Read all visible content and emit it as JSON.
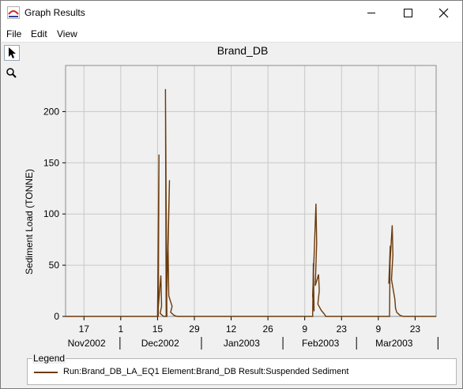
{
  "window": {
    "title": "Graph Results"
  },
  "menu": {
    "file": "File",
    "edit": "Edit",
    "view": "View"
  },
  "legend": {
    "title": "Legend",
    "entry": "Run:Brand_DB_LA_EQ1 Element:Brand_DB Result:Suspended Sediment",
    "line_color": "#6b3a0c"
  },
  "colors": {
    "series": "#6b3a0c",
    "grid": "#c8c8c8",
    "plot_border": "#8c8c8c"
  },
  "chart_data": {
    "type": "line",
    "title": "Brand_DB",
    "ylabel": "Sediment Load (TONNE)",
    "xlabel": "",
    "xlim": [
      "2002-11-10",
      "2003-03-31"
    ],
    "ylim": [
      0,
      245
    ],
    "yticks": [
      0,
      50,
      100,
      150,
      200
    ],
    "xticks_major": [
      "2002-11-17",
      "2002-12-01",
      "2002-12-15",
      "2002-12-29",
      "2003-01-12",
      "2003-01-26",
      "2003-02-09",
      "2003-02-23",
      "2003-03-09",
      "2003-03-23"
    ],
    "xtick_labels_major": [
      "17",
      "1",
      "15",
      "29",
      "12",
      "26",
      "9",
      "23",
      "9",
      "23"
    ],
    "month_boundaries": [
      "2002-12-01",
      "2003-01-01",
      "2003-02-01",
      "2003-03-01",
      "2003-04-01"
    ],
    "month_labels": [
      {
        "label": "Nov2002",
        "center": "2002-11-18"
      },
      {
        "label": "Dec2002",
        "center": "2002-12-16"
      },
      {
        "label": "Jan2003",
        "center": "2003-01-16"
      },
      {
        "label": "Feb2003",
        "center": "2003-02-15"
      },
      {
        "label": "Mar2003",
        "center": "2003-03-15"
      }
    ],
    "grid": true,
    "legend": "bottom",
    "series": [
      {
        "name": "Run:Brand_DB_LA_EQ1 Element:Brand_DB Result:Suspended Sediment",
        "points": [
          [
            "2002-11-10",
            0
          ],
          [
            "2002-12-15",
            0
          ],
          [
            "2002-12-15",
            158
          ],
          [
            "2002-12-15",
            0
          ],
          [
            "2002-12-16",
            40
          ],
          [
            "2002-12-16",
            10
          ],
          [
            "2002-12-16",
            3
          ],
          [
            "2002-12-17",
            0
          ],
          [
            "2002-12-18",
            0
          ],
          [
            "2002-12-18",
            222
          ],
          [
            "2002-12-18",
            0
          ],
          [
            "2002-12-19",
            133
          ],
          [
            "2002-12-19",
            67
          ],
          [
            "2002-12-19",
            20
          ],
          [
            "2002-12-20",
            10
          ],
          [
            "2002-12-20",
            4
          ],
          [
            "2002-12-21",
            1
          ],
          [
            "2002-12-22",
            0
          ],
          [
            "2003-02-12",
            0
          ],
          [
            "2003-02-12",
            52
          ],
          [
            "2003-02-12",
            5
          ],
          [
            "2003-02-12",
            20
          ],
          [
            "2003-02-13",
            110
          ],
          [
            "2003-02-13",
            72
          ],
          [
            "2003-02-13",
            30
          ],
          [
            "2003-02-14",
            41
          ],
          [
            "2003-02-14",
            25
          ],
          [
            "2003-02-14",
            12
          ],
          [
            "2003-02-15",
            6
          ],
          [
            "2003-02-16",
            2
          ],
          [
            "2003-02-17",
            0
          ],
          [
            "2003-03-13",
            0
          ],
          [
            "2003-03-13",
            69
          ],
          [
            "2003-03-13",
            32
          ],
          [
            "2003-03-14",
            89
          ],
          [
            "2003-03-14",
            60
          ],
          [
            "2003-03-14",
            36
          ],
          [
            "2003-03-15",
            17
          ],
          [
            "2003-03-15",
            8
          ],
          [
            "2003-03-16",
            4
          ],
          [
            "2003-03-17",
            1
          ],
          [
            "2003-03-18",
            0
          ],
          [
            "2003-03-31",
            0
          ]
        ]
      }
    ]
  }
}
